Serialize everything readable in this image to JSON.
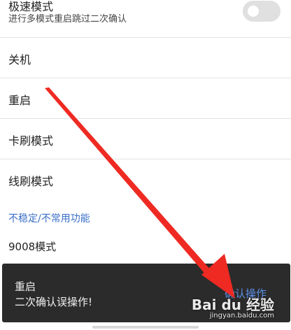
{
  "settings": {
    "fast_mode": {
      "label": "极速模式",
      "sub": "进行多模式重启跳过二次确认",
      "enabled": false
    },
    "items": [
      {
        "label": "关机"
      },
      {
        "label": "重启"
      },
      {
        "label": "卡刷模式"
      },
      {
        "label": "线刷模式"
      }
    ],
    "section_header": "不稳定/不常用功能",
    "last_item": "9008模式"
  },
  "toast": {
    "title": "重启",
    "message": "二次确认误操作!",
    "action": "确认操作"
  },
  "colors": {
    "accent": "#3a6fc9",
    "toast_bg": "#2b2b2b",
    "arrow": "#ee2a22"
  },
  "watermark": {
    "logo": "Bai du 经验",
    "url": "jingyan.baidu.com"
  }
}
